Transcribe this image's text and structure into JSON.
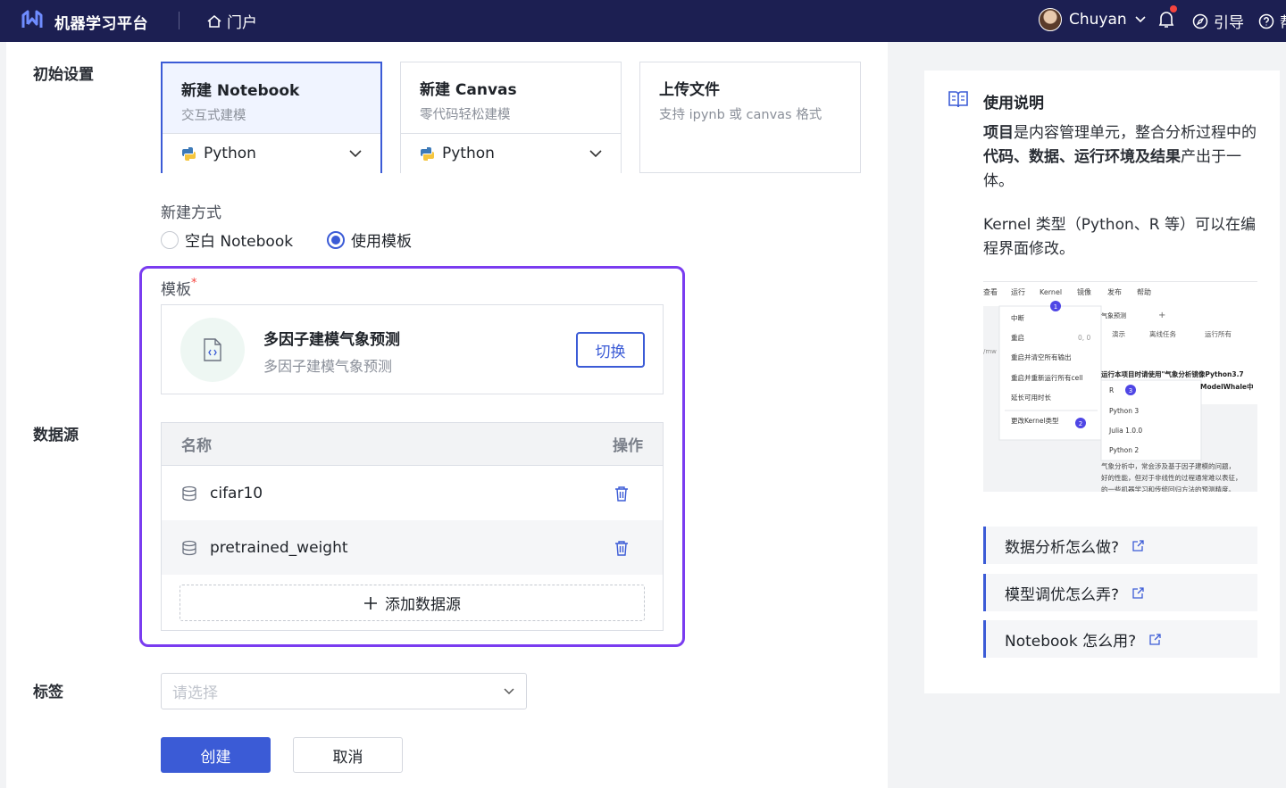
{
  "topbar": {
    "brand": "机器学习平台",
    "portal": "门户",
    "user_name": "Chuyan",
    "guide": "引导",
    "help": "帮助"
  },
  "labels": {
    "init": "初始设置",
    "datasource": "数据源",
    "tags": "标签"
  },
  "cards": [
    {
      "title": "新建 Notebook",
      "subtitle": "交互式建模",
      "select": "Python",
      "selected": true
    },
    {
      "title": "新建 Canvas",
      "subtitle": "零代码轻松建模",
      "select": "Python",
      "selected": false
    },
    {
      "title": "上传文件",
      "subtitle": "支持 ipynb 或 canvas 格式",
      "selected": false
    }
  ],
  "method": {
    "title": "新建方式",
    "options": [
      "空白 Notebook",
      "使用模板"
    ],
    "selected": "使用模板"
  },
  "template": {
    "label": "模板",
    "required_mark": "*",
    "name": "多因子建模气象预测",
    "desc": "多因子建模气象预测",
    "switch_label": "切换"
  },
  "datasource_table": {
    "col_name": "名称",
    "col_action": "操作",
    "rows": [
      "cifar10",
      "pretrained_weight"
    ],
    "add_label": "添加数据源"
  },
  "tag_select": {
    "placeholder": "请选择"
  },
  "buttons": {
    "create": "创建",
    "cancel": "取消"
  },
  "side": {
    "title": "使用说明",
    "p1_b1": "项目",
    "p1_t1": "是内容管理单元，整合分析过程中的",
    "p1_b2": "代码、数据、运行环境及结果",
    "p1_t2": "产出于一体。",
    "p2": "Kernel 类型（Python、R 等）可以在编程界面修改。",
    "screenshot": {
      "menu": [
        "查看",
        "运行",
        "Kernel",
        "镜像",
        "发布",
        "帮助"
      ],
      "dropdown": [
        "中断",
        "重启",
        "重启并清空所有输出",
        "重启并重新运行所有cell",
        "延长可用时长",
        "更改Kernel类型"
      ],
      "tab": "气象预测",
      "toolbar": [
        "演示",
        "离线任务",
        "运行所有"
      ],
      "coords": "0, 0",
      "notice": "运行本项目时请使用\"气象分析镜像Python3.7",
      "notice2": "ModelWhale中",
      "kernels": [
        "R",
        "Python 3",
        "Julia 1.0.0",
        "Python 2"
      ],
      "badges": [
        "1",
        "2",
        "3"
      ],
      "body": [
        "气象分析中，常会涉及基于因子建模的问题，",
        "好的性能，但对于非线性的过程通常难以表征，",
        "的一些机器学习和传统回归方法的预测精度。"
      ],
      "left": "/mw"
    },
    "faqs": [
      "数据分析怎么做?",
      "模型调优怎么弄?",
      "Notebook 怎么用?"
    ]
  },
  "colors": {
    "nav_bg": "#1c1f52",
    "primary": "#3b5bd6",
    "highlight": "#7a3cf0"
  }
}
